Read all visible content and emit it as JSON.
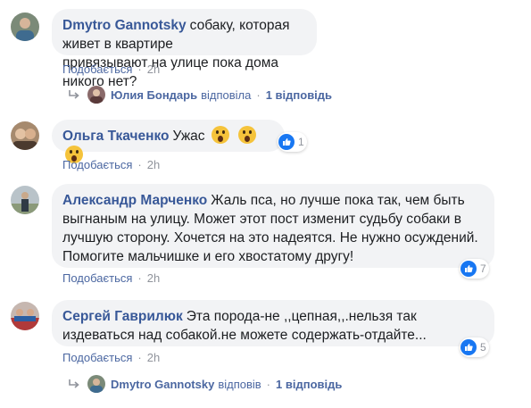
{
  "comments": [
    {
      "author": "Dmytro Gannotsky",
      "text_lines": [
        "собаку, которая живет в квартире",
        "привязывают на улице пока дома никого нет?"
      ],
      "like_label": "Подобається",
      "time": "2h",
      "reply": {
        "name": "Юлия Бондарь",
        "verb": "відповіла",
        "count": "1 відповідь"
      }
    },
    {
      "author": "Ольга Ткаченко",
      "text": "Ужас",
      "emoji": "scream-emoji",
      "reaction_count": "1",
      "like_label": "Подобається",
      "time": "2h"
    },
    {
      "author": "Александр Марченко",
      "text_lines": [
        "Жаль пса, но лучше пока так, чем быть",
        "выгнаным на улицу. Может этот пост изменит судьбу собаки в",
        "лучшую сторону. Хочется на это надеятся. Не нужно осуждений.",
        "Помогите мальчишке и его хвостатому другу!"
      ],
      "reaction_count": "7",
      "like_label": "Подобається",
      "time": "2h"
    },
    {
      "author": "Сергей Гаврилюк",
      "text_lines": [
        "Эта порода-не ,,цепная,,.нельзя так",
        "издеваться над собакой.не можете содержать-отдайте..."
      ],
      "reaction_count": "5",
      "like_label": "Подобається",
      "time": "2h",
      "reply": {
        "name": "Dmytro Gannotsky",
        "verb": "відповів",
        "count": "1 відповідь"
      }
    }
  ],
  "separator": "·",
  "colors": {
    "link": "#385898",
    "bubble": "#f2f3f5",
    "like": "#1877f2",
    "meta": "#90949c"
  },
  "icons": {
    "like": "thumbs-up-icon",
    "reply": "reply-arrow-icon"
  }
}
